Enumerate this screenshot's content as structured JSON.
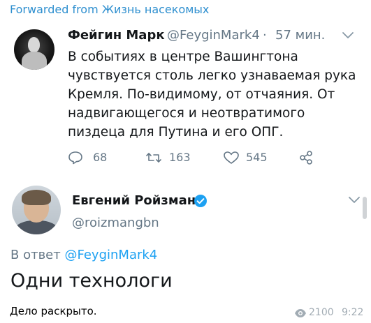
{
  "forwarded": "Forwarded from Жизнь насекомых",
  "tweet1": {
    "name": "Фейгин Марк",
    "handle": "@FeyginMark4",
    "separator": "·",
    "time": "57 мин.",
    "text": "В событиях в центре Вашингтона чувствуется столь легко узнаваемая рука Кремля. По-видимому, от отчаяния. От надвигающегося и неотвратимого пиздеца для Путина и его ОПГ.",
    "replies": "68",
    "retweets": "163",
    "likes": "545",
    "icons": [
      "reply-icon",
      "retweet-icon",
      "like-icon",
      "share-icon",
      "chevron-down-icon"
    ]
  },
  "tweet2": {
    "name": "Евгений Ройзман",
    "handle": "@roizmangbn",
    "reply_prefix": "В ответ",
    "reply_mention": "@FeyginMark4",
    "text": "Одни технологи",
    "icons": [
      "verified-badge-icon",
      "chevron-down-icon"
    ]
  },
  "message": {
    "caption": "Дело раскрыто.",
    "views": "2100",
    "time": "9:22"
  },
  "colors": {
    "forward_link": "#2e8fcf",
    "mention": "#1da1f2",
    "verified": "#1da1f2",
    "secondary": "#657786",
    "meta": "#a2acb4"
  }
}
